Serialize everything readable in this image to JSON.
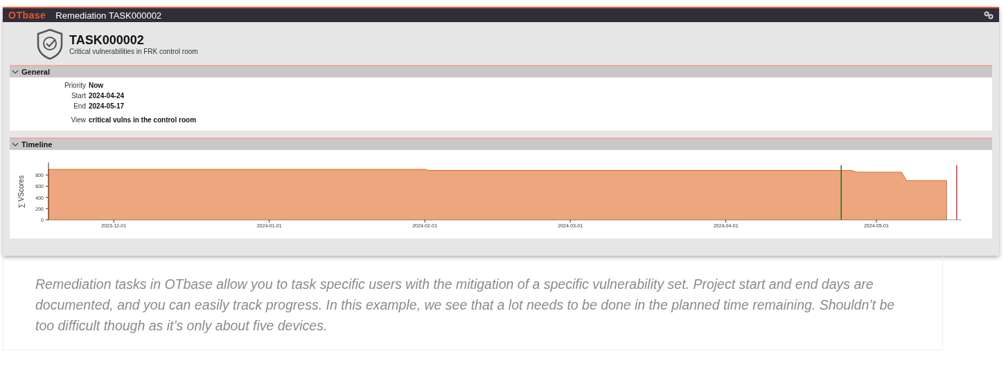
{
  "window": {
    "logo": "OTbase",
    "title": "Remediation TASK000002"
  },
  "task": {
    "id": "TASK000002",
    "subtitle": "Critical vulnerabilities in FRK control room"
  },
  "sections": [
    {
      "title": "General",
      "expanded": true,
      "kind": "fields",
      "fields": [
        {
          "label": "Priority",
          "value": "Now"
        },
        {
          "label": "Start",
          "value": "2024-04-24"
        },
        {
          "label": "End",
          "value": "2024-05-17"
        },
        {
          "label": "View",
          "value": "critical vulns in the control room"
        }
      ]
    },
    {
      "title": "Timeline",
      "expanded": true,
      "kind": "chart",
      "chart_data": {
        "type": "area",
        "ylabel": "∑ VScores",
        "x": [
          "2023-11-18",
          "2024-02-01",
          "2024-02-02",
          "2024-04-26",
          "2024-04-27",
          "2024-05-06",
          "2024-05-07",
          "2024-05-15"
        ],
        "values": [
          900,
          900,
          880,
          880,
          850,
          850,
          700,
          700
        ],
        "xlim": [
          "2023-11-18",
          "2024-05-18"
        ],
        "ylim": [
          0,
          1000
        ],
        "xticks": [
          {
            "value": "2023-12-01",
            "label": "2023-12-01"
          },
          {
            "value": "2024-01-01",
            "label": "2024-01-01"
          },
          {
            "value": "2024-02-01",
            "label": "2024-02-01"
          },
          {
            "value": "2024-03-01",
            "label": "2024-03-01"
          },
          {
            "value": "2024-04-01",
            "label": "2024-04-01"
          },
          {
            "value": "2024-05-01",
            "label": "2024-05-01"
          }
        ],
        "yticks": [
          0,
          200,
          400,
          600,
          800
        ],
        "ref_lines": [
          {
            "axis": "x",
            "value": "2024-04-24",
            "color": "#2e6b0f"
          },
          {
            "axis": "x",
            "value": "2024-05-17",
            "color": "#e83030"
          }
        ]
      }
    }
  ],
  "caption": "Remediation tasks in OTbase allow you to task specific users with the mitigation of a specific vulnerability set. Project start and end days are documented, and you can easily track progress. In this example, we see that a lot needs to be done in the planned time remaining. Shouldn’t be too difficult though as it’s only about five devices."
}
